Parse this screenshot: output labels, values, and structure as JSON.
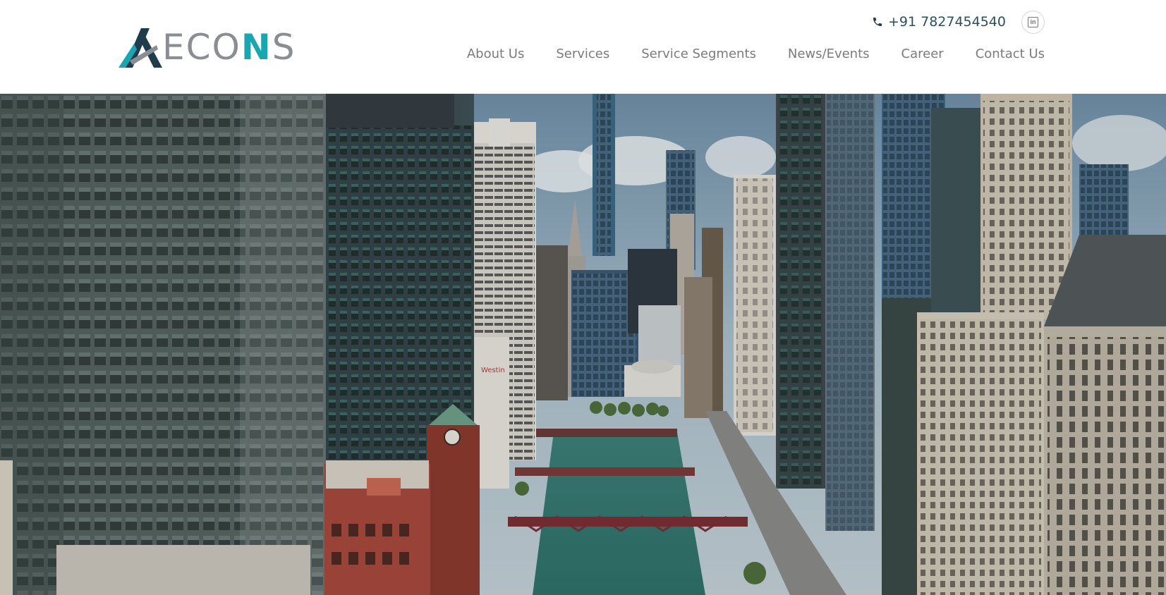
{
  "brand": {
    "name": "AECONS",
    "logo_prefix": "ECO",
    "logo_highlight": "N",
    "logo_suffix": "S",
    "colors": {
      "accent": "#1aa6b0",
      "dark": "#1f3c4c",
      "gray": "#8a8d92"
    }
  },
  "topbar": {
    "phone": "+91 7827454540",
    "phone_icon": "phone-icon",
    "social_icon": "linkedin-icon"
  },
  "nav": {
    "items": [
      {
        "label": "About Us"
      },
      {
        "label": "Services"
      },
      {
        "label": "Service Segments"
      },
      {
        "label": "News/Events"
      },
      {
        "label": "Career"
      },
      {
        "label": "Contact Us"
      }
    ]
  },
  "hero": {
    "sign_text": "Westin"
  }
}
